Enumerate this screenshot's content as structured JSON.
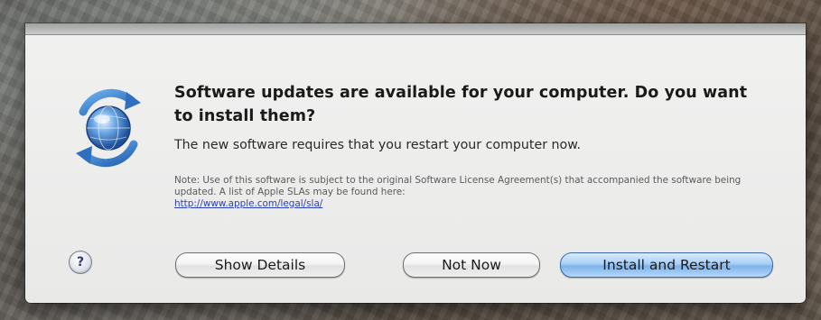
{
  "dialog": {
    "headline": "Software updates are available for your computer. Do you want to install them?",
    "subtext": "The new software requires that you restart your computer now.",
    "note_text": "Note: Use of this software is subject to the original Software License Agreement(s) that accompanied the software being updated. A list of Apple SLAs may be found here:",
    "note_link": "http://www.apple.com/legal/sla/",
    "icon": "software-update-globe-icon",
    "help_label": "?"
  },
  "buttons": {
    "show_details": "Show Details",
    "not_now": "Not Now",
    "install_restart": "Install and Restart"
  },
  "colors": {
    "sheet_background": "#efefee",
    "default_button": "#8fc0f0",
    "link": "#2b3fb5"
  }
}
